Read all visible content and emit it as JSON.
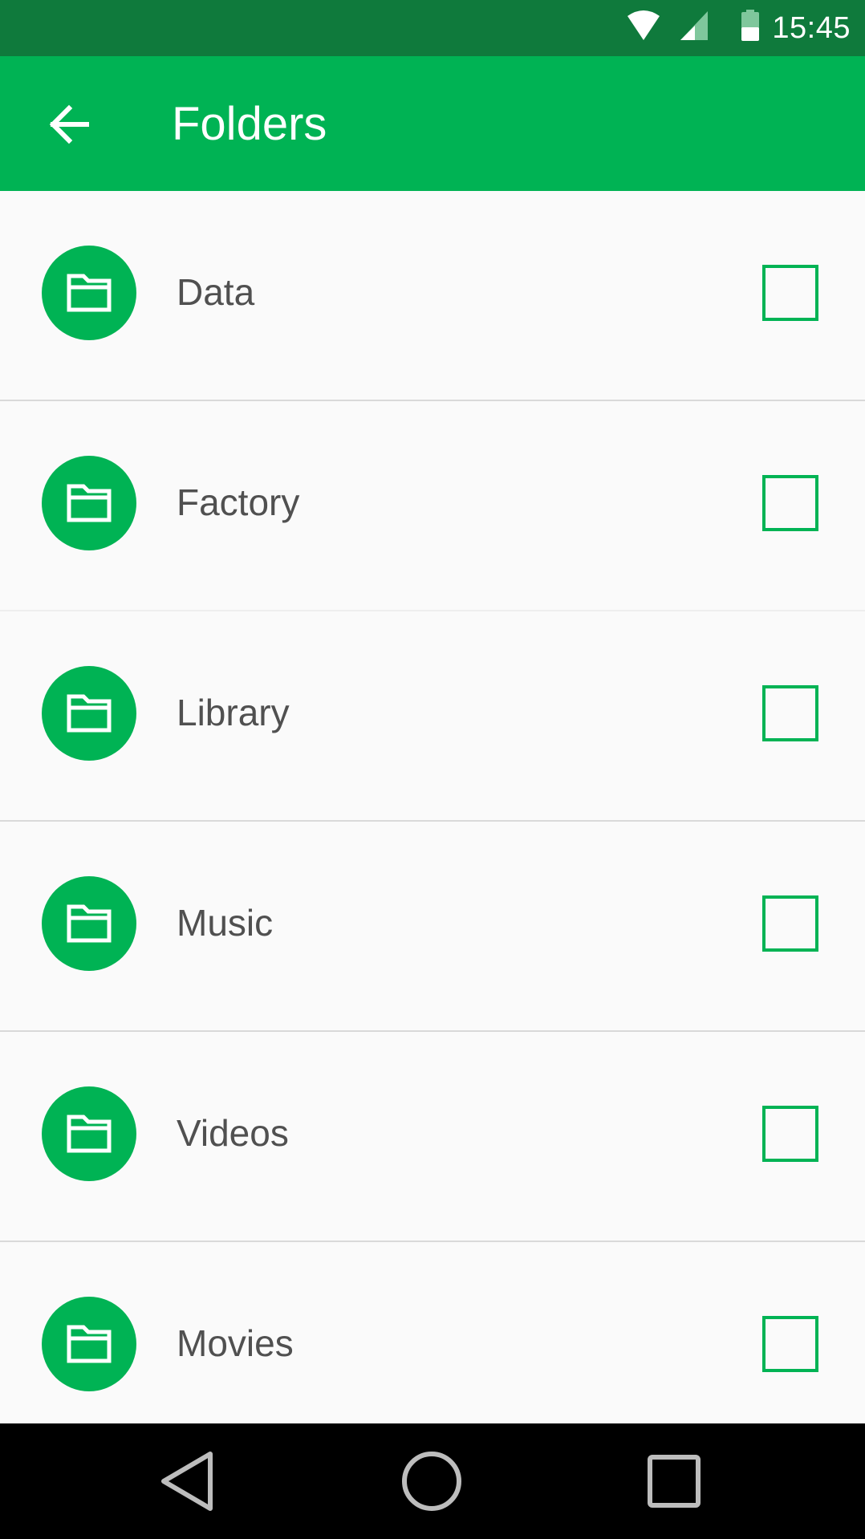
{
  "status_bar": {
    "time": "15:45",
    "icons": [
      "wifi-icon",
      "cell-signal-icon",
      "battery-icon"
    ]
  },
  "app_bar": {
    "back_icon": "arrow-left-icon",
    "title": "Folders"
  },
  "folders": [
    {
      "name": "Data",
      "icon": "folder-icon",
      "checked": false
    },
    {
      "name": "Factory",
      "icon": "folder-icon",
      "checked": false
    },
    {
      "name": "Library",
      "icon": "folder-icon",
      "checked": false
    },
    {
      "name": "Music",
      "icon": "folder-icon",
      "checked": false
    },
    {
      "name": "Videos",
      "icon": "folder-icon",
      "checked": false
    },
    {
      "name": "Movies",
      "icon": "folder-icon",
      "checked": false
    }
  ],
  "nav_bar": {
    "buttons": [
      "back-triangle-icon",
      "home-circle-icon",
      "recents-square-icon"
    ]
  },
  "colors": {
    "accent": "#00b354",
    "status_bar": "#0f7a3c",
    "text": "#505050",
    "background": "#fafafa"
  }
}
